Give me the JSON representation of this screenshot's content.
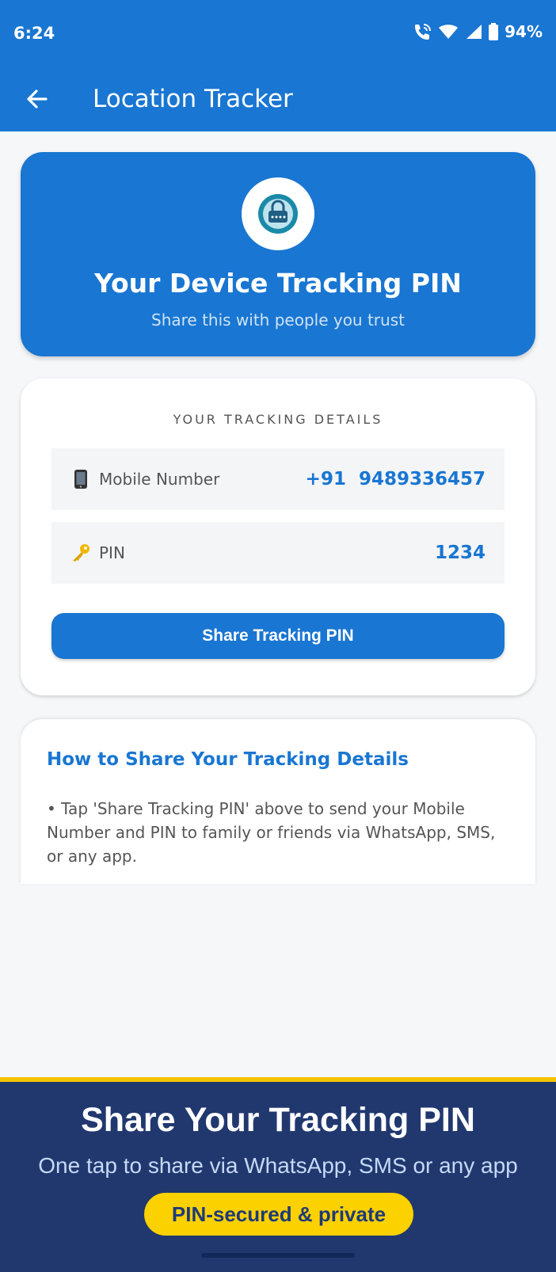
{
  "status_bar": {
    "time": "6:24",
    "battery": "94%"
  },
  "app_bar": {
    "title": "Location Tracker"
  },
  "hero": {
    "title": "Your Device Tracking PIN",
    "subtitle": "Share this with people you trust"
  },
  "details": {
    "heading": "YOUR TRACKING DETAILS",
    "mobile_label": "Mobile Number",
    "mobile_value": "+91  9489336457",
    "pin_label": "PIN",
    "pin_value": "1234",
    "share_button": "Share Tracking PIN"
  },
  "howto": {
    "title": "How to Share Your Tracking Details",
    "text": "• Tap 'Share Tracking PIN' above to send your Mobile Number and PIN to family or friends via WhatsApp, SMS, or any app."
  },
  "banner": {
    "title": "Share Your Tracking PIN",
    "subtitle": "One tap to share via WhatsApp, SMS or any app",
    "badge": "PIN-secured & private"
  },
  "colors": {
    "primary": "#1976d2",
    "banner_bg": "#21386f",
    "accent_yellow": "#fcd100"
  }
}
